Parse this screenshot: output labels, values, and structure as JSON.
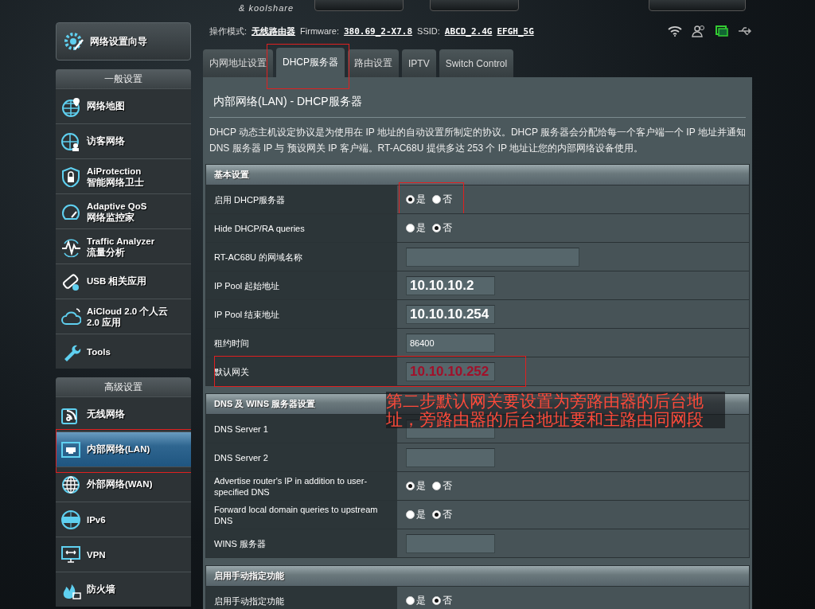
{
  "header": {
    "tagline": "& koolshare"
  },
  "status_bar": {
    "items": [
      {
        "label": "操作模式:",
        "values": [
          "无线路由器"
        ]
      },
      {
        "label": "Firmware:",
        "values": [
          "380.69_2-X7.8"
        ]
      },
      {
        "label": "SSID:",
        "values": [
          "ABCD_2.4G",
          "EFGH_5G"
        ]
      }
    ]
  },
  "sidebar": {
    "wizard": "网络设置向导",
    "groups": [
      {
        "title": "一般设置",
        "items": [
          {
            "label": "网络地图",
            "selected": false
          },
          {
            "label": "访客网络",
            "selected": false
          },
          {
            "label": "AiProtection",
            "sublabel": "智能网络卫士",
            "selected": false
          },
          {
            "label": "Adaptive QoS",
            "sublabel": "网络监控家",
            "selected": false
          },
          {
            "label": "Traffic Analyzer",
            "sublabel": "流量分析",
            "selected": false
          },
          {
            "label": "USB 相关应用",
            "selected": false
          },
          {
            "label": "AiCloud 2.0 个人云",
            "sublabel": "2.0 应用",
            "selected": false
          },
          {
            "label": "Tools",
            "selected": false
          }
        ]
      },
      {
        "title": "高级设置",
        "items": [
          {
            "label": "无线网络",
            "selected": false
          },
          {
            "label": "内部网络(LAN)",
            "selected": true,
            "highlighted": true
          },
          {
            "label": "外部网络(WAN)",
            "selected": false
          },
          {
            "label": "IPv6",
            "selected": false
          },
          {
            "label": "VPN",
            "selected": false
          },
          {
            "label": "防火墙",
            "selected": false
          }
        ]
      }
    ]
  },
  "tabs": [
    {
      "label": "内网地址设置",
      "selected": false
    },
    {
      "label": "DHCP服务器",
      "selected": true,
      "highlighted": true
    },
    {
      "label": "路由设置",
      "selected": false
    },
    {
      "label": "IPTV",
      "selected": false
    },
    {
      "label": "Switch Control",
      "selected": false
    }
  ],
  "panel": {
    "title": "内部网络(LAN) - DHCP服务器",
    "description": "DHCP 动态主机设定协议是为使用在 IP 地址的自动设置所制定的协议。DHCP 服务器会分配给每一个客户端一个 IP 地址并通知 DNS 服务器 IP 与 预设网关 IP 客户端。RT-AC68U 提供多达 253 个 IP 地址让您的内部网络设备使用。",
    "sections": [
      {
        "title": "基本设置",
        "rows": [
          {
            "label": "启用 DHCP服务器",
            "kind": "radio",
            "highlighted": true,
            "options": [
              {
                "label": "是",
                "selected": true
              },
              {
                "label": "否",
                "selected": false
              }
            ]
          },
          {
            "label": "Hide DHCP/RA queries",
            "kind": "radio",
            "options": [
              {
                "label": "是",
                "selected": false
              },
              {
                "label": "否",
                "selected": true
              }
            ]
          },
          {
            "label": "RT-AC68U 的网域名称",
            "kind": "field",
            "wide": true
          },
          {
            "label": "IP Pool 起始地址",
            "kind": "field",
            "value": "10.10.10.2",
            "large": true
          },
          {
            "label": "IP Pool 结束地址",
            "kind": "field",
            "value": "10.10.10.254",
            "large": true
          },
          {
            "label": "租约时间",
            "kind": "field",
            "value": "86400"
          },
          {
            "label": "默认网关",
            "kind": "field",
            "value": "10.10.10.252",
            "large": true,
            "emphasized": true,
            "highlighted": true
          }
        ]
      },
      {
        "title": "DNS 及 WINS 服务器设置",
        "rows": [
          {
            "label": "DNS Server 1",
            "kind": "field"
          },
          {
            "label": "DNS Server 2",
            "kind": "field"
          },
          {
            "label": "Advertise router's IP in addition to user-specified DNS",
            "kind": "radio",
            "options": [
              {
                "label": "是",
                "selected": true
              },
              {
                "label": "否",
                "selected": false
              }
            ]
          },
          {
            "label": "Forward local domain queries to upstream DNS",
            "kind": "radio",
            "options": [
              {
                "label": "是",
                "selected": false
              },
              {
                "label": "否",
                "selected": true
              }
            ]
          },
          {
            "label": "WINS 服务器",
            "kind": "field"
          }
        ]
      },
      {
        "title": "启用手动指定功能",
        "rows": [
          {
            "label": "启用手动指定功能",
            "kind": "radio",
            "options": [
              {
                "label": "是",
                "selected": false
              },
              {
                "label": "否",
                "selected": true
              }
            ]
          }
        ]
      }
    ]
  },
  "annotation": {
    "text": "第二步默认网关要设置为旁路由器的后台地址，旁路由器的后台地址要和主路由同网段"
  }
}
